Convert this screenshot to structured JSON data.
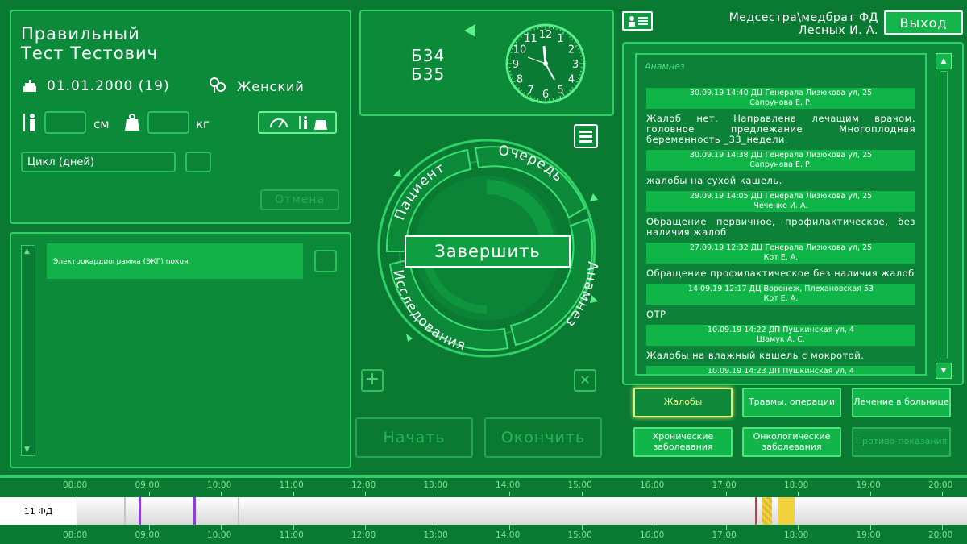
{
  "patient": {
    "name_line1": "Правильный",
    "name_line2": "Тест Тестович",
    "dob": "01.01.2000 (19)",
    "gender": "Женский",
    "height_unit": "см",
    "weight_unit": "кг",
    "cycle_label": "Цикл (дней)",
    "cancel_label": "Отмена"
  },
  "icons": {
    "cake": "cake-icon",
    "gender": "gender-icon",
    "height": "height-icon",
    "weight": "weight-icon",
    "measure": "measurements-icon",
    "badge": "id-card-icon"
  },
  "header": {
    "user_line1": "Медсестра\\медбрат ФД",
    "user_line2": "Лесных И. А.",
    "logout_label": "Выход"
  },
  "rooms": {
    "line1": "Б34",
    "line2": "Б35"
  },
  "clock": {
    "numbers": [
      "12",
      "1",
      "2",
      "3",
      "4",
      "5",
      "6",
      "7",
      "8",
      "9",
      "10",
      "11"
    ]
  },
  "dial": {
    "center_label": "Завершить",
    "segments": [
      "Пациент",
      "Очередь",
      "Анамнез",
      "Исследования"
    ]
  },
  "studies": {
    "items": [
      "Электрокардиограмма (ЭКГ) покоя"
    ],
    "start_label": "Начать",
    "finish_label": "Окончить"
  },
  "anamnesis": {
    "title": "Анамнез",
    "entries": [
      {
        "head1": "30.09.19 14:40 ДЦ Генерала Лизюкова ул, 25",
        "head2": "Сапрунова Е. Р.",
        "text": "Жалоб нет. Направлена лечащим врачом. головное предлежание Многоплодная беременность _33_недели."
      },
      {
        "head1": "30.09.19 14:38 ДЦ Генерала Лизюкова ул, 25",
        "head2": "Сапрунова Е. Р.",
        "text": "жалобы на сухой кашель."
      },
      {
        "head1": "29.09.19 14:05 ДЦ Генерала Лизюкова ул, 25",
        "head2": "Чеченко И. А.",
        "text": "Обращение первичное, профилактическое, без наличия жалоб."
      },
      {
        "head1": "27.09.19 12:32 ДЦ Генерала Лизюкова ул, 25",
        "head2": "Кот Е. А.",
        "text": "Обращение профилактическое без наличия жалоб"
      },
      {
        "head1": "14.09.19 12:17 ДЦ Воронеж, Плехановская 53",
        "head2": "Кот Е. А.",
        "text": "ОТР"
      },
      {
        "head1": "10.09.19 14:22 ДП Пушкинская ул, 4",
        "head2": "Шамук А. С.",
        "text": "Жалобы на влажный кашель с мокротой."
      },
      {
        "head1": "10.09.19 14:23 ДП Пушкинская ул, 4",
        "head2": "",
        "text": ""
      }
    ]
  },
  "categories": [
    {
      "label": "Жалобы",
      "active": true
    },
    {
      "label": "Травмы, операции"
    },
    {
      "label": "Лечение в больнице"
    },
    {
      "label": "Хронические заболевания"
    },
    {
      "label": "Онкологические заболевания"
    },
    {
      "label": "Противо-показания",
      "disabled": true
    }
  ],
  "timeline": {
    "room_label": "11 ФД",
    "hours": [
      "08:00",
      "09:00",
      "10:00",
      "11:00",
      "12:00",
      "13:00",
      "14:00",
      "15:00",
      "16:00",
      "17:00",
      "18:00",
      "19:00",
      "20:00"
    ]
  },
  "colors": {
    "bg": "#0a7a33",
    "accent": "#2fd063",
    "purple": "#8a3ee0",
    "yellow": "#f2d23a"
  }
}
